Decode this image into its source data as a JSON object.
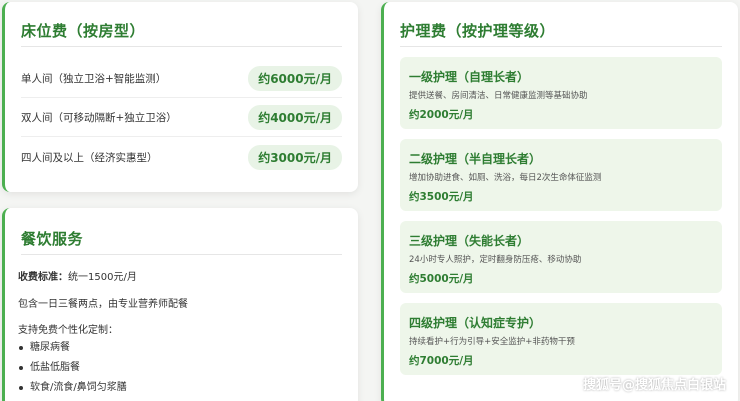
{
  "bed": {
    "title": "床位费（按房型）",
    "rows": [
      {
        "label": "单人间（独立卫浴+智能监测）",
        "price": "约6000元/月"
      },
      {
        "label": "双人间（可移动隔断+独立卫浴）",
        "price": "约4000元/月"
      },
      {
        "label": "四人间及以上（经济实惠型）",
        "price": "约3000元/月"
      }
    ]
  },
  "food": {
    "title": "餐饮服务",
    "standard_label": "收费标准：",
    "standard_value": "统一1500元/月",
    "includes": "包含一日三餐两点，由专业营养师配餐",
    "custom_intro": "支持免费个性化定制：",
    "custom_items": [
      "糖尿病餐",
      "低盐低脂餐",
      "软食/流食/鼻饲匀浆膳"
    ]
  },
  "care": {
    "title": "护理费（按护理等级）",
    "levels": [
      {
        "title": "一级护理（自理长者）",
        "desc": "提供送餐、房间清洁、日常健康监测等基础协助",
        "price": "约2000元/月"
      },
      {
        "title": "二级护理（半自理长者）",
        "desc": "增加协助进食、如厕、洗浴，每日2次生命体征监测",
        "price": "约3500元/月"
      },
      {
        "title": "三级护理（失能长者）",
        "desc": "24小时专人照护，定时翻身防压疮、移动协助",
        "price": "约5000元/月"
      },
      {
        "title": "四级护理（认知症专护）",
        "desc": "持续看护+行为引导+安全监护+非药物干预",
        "price": "约7000元/月"
      }
    ]
  },
  "watermark": "搜狐号@搜狐焦点白银站",
  "colors": {
    "accent": "#2e7d32",
    "border": "#4caf50",
    "pill_bg": "#e8f3e6",
    "box_bg": "#eef6ea"
  }
}
